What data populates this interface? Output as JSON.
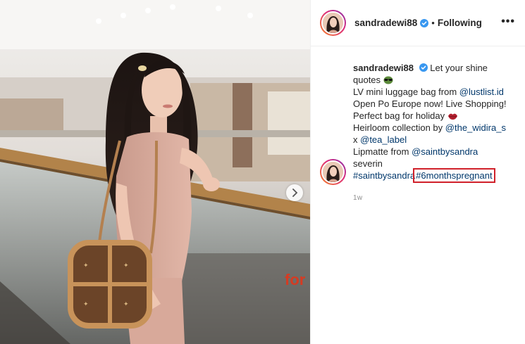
{
  "post": {
    "username": "sandradewi88",
    "follow_sep": "•",
    "follow_label": "Following",
    "more_label": "•••",
    "caption_lines": [
      {
        "text": "Let your shine"
      },
      {
        "text": "quotes"
      },
      {
        "text": "LV mini luggage bag from ",
        "link": "@lustlist.id"
      },
      {
        "text": "Open Po Europe now! Live Shopping!"
      },
      {
        "text": "Perfect bag for holiday"
      },
      {
        "text": "Heirloom collection by ",
        "link": "@the_widira_s"
      },
      {
        "text": "x ",
        "link": "@tea_label"
      },
      {
        "text": "Lipmatte from ",
        "link": "@saintbysandra"
      },
      {
        "text": "severin"
      },
      {
        "link": "#saintbysandra",
        "highlight": "#6monthspregnant"
      }
    ],
    "time_ago": "1w"
  },
  "icons": {
    "verified": "verified-badge-icon",
    "next": "chevron-right-icon",
    "more": "more-options-icon",
    "emoji_sunglasses": "sunglasses-emoji-icon",
    "emoji_lips": "lips-emoji-icon"
  },
  "colors": {
    "link": "#00376b",
    "verified": "#3897f0",
    "highlight_box": "#d0202a",
    "text": "#262626",
    "muted": "#8e8e8e"
  }
}
